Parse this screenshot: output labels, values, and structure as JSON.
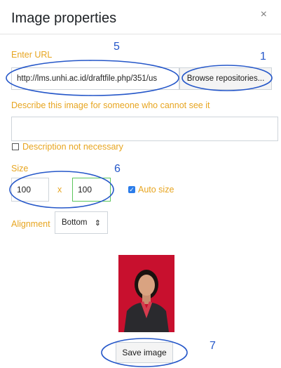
{
  "dialog": {
    "title": "Image properties",
    "close_icon": "×"
  },
  "url_section": {
    "label": "Enter URL",
    "value": "http://lms.unhi.ac.id/draftfile.php/351/us",
    "browse_label": "Browse repositories..."
  },
  "description": {
    "label": "Describe this image for someone who cannot see it",
    "value": "",
    "not_necessary_label": "Description not necessary",
    "not_necessary_checked": false
  },
  "size": {
    "label": "Size",
    "width": "100",
    "separator": "x",
    "height": "100",
    "auto_size_label": "Auto size",
    "auto_size_checked": true
  },
  "alignment": {
    "label": "Alignment",
    "value": "Bottom",
    "arrow": "⇕"
  },
  "save_label": "Save image",
  "annotations": {
    "n1": "1",
    "n5": "5",
    "n6": "6",
    "n7": "7",
    "color": "#2557c9"
  },
  "colors": {
    "label": "#e7a520",
    "accent": "#2b7ce9",
    "photo_bg": "#c8102e"
  }
}
